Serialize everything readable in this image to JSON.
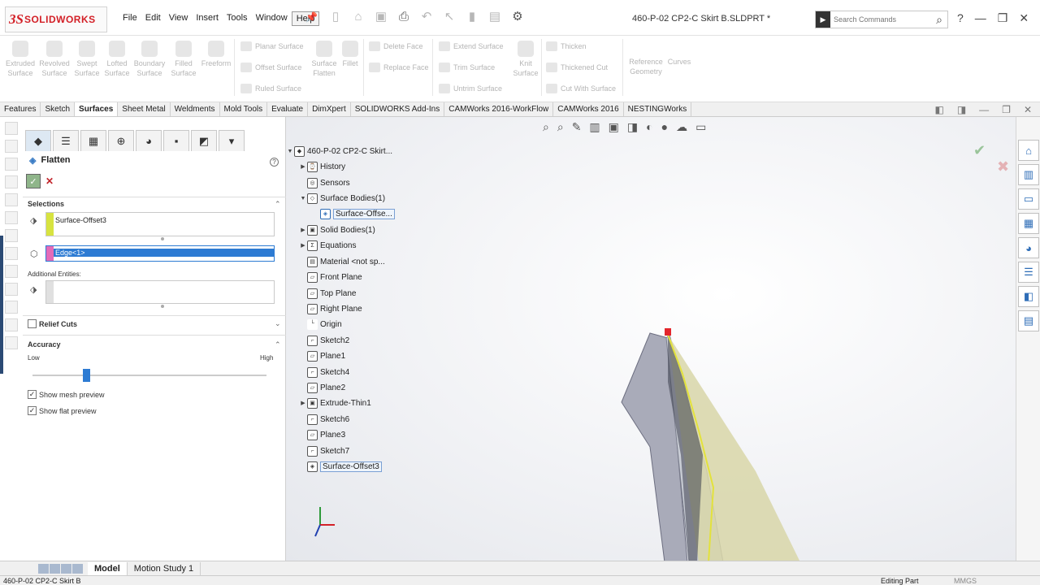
{
  "window": {
    "doc_title": "460-P-02 CP2-C Skirt B.SLDPRT *"
  },
  "logo": {
    "brand_mark": "3S",
    "brand_name": "SOLIDWORKS"
  },
  "menu": [
    "File",
    "Edit",
    "View",
    "Insert",
    "Tools",
    "Window",
    "Help"
  ],
  "search": {
    "placeholder": "Search Commands"
  },
  "ribbon": {
    "big_buttons": [
      {
        "label": "Extruded Surface"
      },
      {
        "label": "Revolved Surface"
      },
      {
        "label": "Swept Surface"
      },
      {
        "label": "Lofted Surface"
      },
      {
        "label": "Boundary Surface"
      },
      {
        "label": "Filled Surface"
      },
      {
        "label": "Freeform"
      }
    ],
    "col1": [
      "Planar Surface",
      "Offset Surface",
      "Ruled Surface"
    ],
    "flatten": "Surface Flatten",
    "fillet": "Fillet",
    "col2": [
      "Delete Face",
      "Replace Face"
    ],
    "col3": [
      "Extend Surface",
      "Trim Surface",
      "Untrim Surface"
    ],
    "knit": "Knit Surface",
    "col4": [
      "Thicken",
      "Thickened Cut",
      "Cut With Surface"
    ],
    "refgeom": "Reference Geometry",
    "curves": "Curves"
  },
  "command_tabs": [
    "Features",
    "Sketch",
    "Surfaces",
    "Sheet Metal",
    "Weldments",
    "Mold Tools",
    "Evaluate",
    "DimXpert",
    "SOLIDWORKS Add-Ins",
    "CAMWorks 2016-WorkFlow",
    "CAMWorks 2016",
    "NESTINGWorks"
  ],
  "active_command_tab": "Surfaces",
  "pm": {
    "title": "Flatten",
    "help": "?",
    "ok": "✓",
    "cancel": "✕",
    "selections": "Selections",
    "face_selection": "Surface-Offset3",
    "edge_selection": "Edge<1>",
    "additional": "Additional Entities:",
    "relief": "Relief Cuts",
    "accuracy": "Accuracy",
    "low": "Low",
    "high": "High",
    "accuracy_level": 0.25,
    "show_mesh": "Show mesh preview",
    "show_flat": "Show flat preview"
  },
  "tree": [
    {
      "label": "460-P-02 CP2-C Skirt...",
      "arrow": "▼",
      "icon": "part-icon"
    },
    {
      "label": "History",
      "arrow": "▶",
      "icon": "history-icon"
    },
    {
      "label": "Sensors",
      "arrow": "",
      "icon": "sensor-icon"
    },
    {
      "label": "Surface Bodies(1)",
      "arrow": "▼",
      "icon": "surface-bodies-icon"
    },
    {
      "label": "Surface-Offse...",
      "arrow": "",
      "icon": "surface-icon",
      "selected": true
    },
    {
      "label": "Solid Bodies(1)",
      "arrow": "▶",
      "icon": "solid-bodies-icon"
    },
    {
      "label": "Equations",
      "arrow": "▶",
      "icon": "equations-icon"
    },
    {
      "label": "Material <not sp...",
      "arrow": "",
      "icon": "material-icon"
    },
    {
      "label": "Front Plane",
      "arrow": "",
      "icon": "plane-icon"
    },
    {
      "label": "Top Plane",
      "arrow": "",
      "icon": "plane-icon"
    },
    {
      "label": "Right Plane",
      "arrow": "",
      "icon": "plane-icon"
    },
    {
      "label": "Origin",
      "arrow": "",
      "icon": "origin-icon"
    },
    {
      "label": "Sketch2",
      "arrow": "",
      "icon": "sketch-icon"
    },
    {
      "label": "Plane1",
      "arrow": "",
      "icon": "plane-icon"
    },
    {
      "label": "Sketch4",
      "arrow": "",
      "icon": "sketch-icon"
    },
    {
      "label": "Plane2",
      "arrow": "",
      "icon": "plane-icon"
    },
    {
      "label": "Extrude-Thin1",
      "arrow": "▶",
      "icon": "extrude-icon"
    },
    {
      "label": "Sketch6",
      "arrow": "",
      "icon": "sketch-icon"
    },
    {
      "label": "Plane3",
      "arrow": "",
      "icon": "plane-icon"
    },
    {
      "label": "Sketch7",
      "arrow": "",
      "icon": "sketch-icon"
    },
    {
      "label": "Surface-Offset3",
      "arrow": "",
      "icon": "surface-icon",
      "selected": true
    }
  ],
  "bottom_tabs": [
    "Model",
    "Motion Study 1"
  ],
  "status": {
    "file": "460-P-02 CP2-C Skirt B",
    "mode": "Editing Part",
    "units": "MMGS"
  },
  "colors": {
    "accent": "#2d7bd3",
    "face_band": "#d7e340",
    "edge_band": "#e46bb8",
    "brand": "#d32027"
  }
}
